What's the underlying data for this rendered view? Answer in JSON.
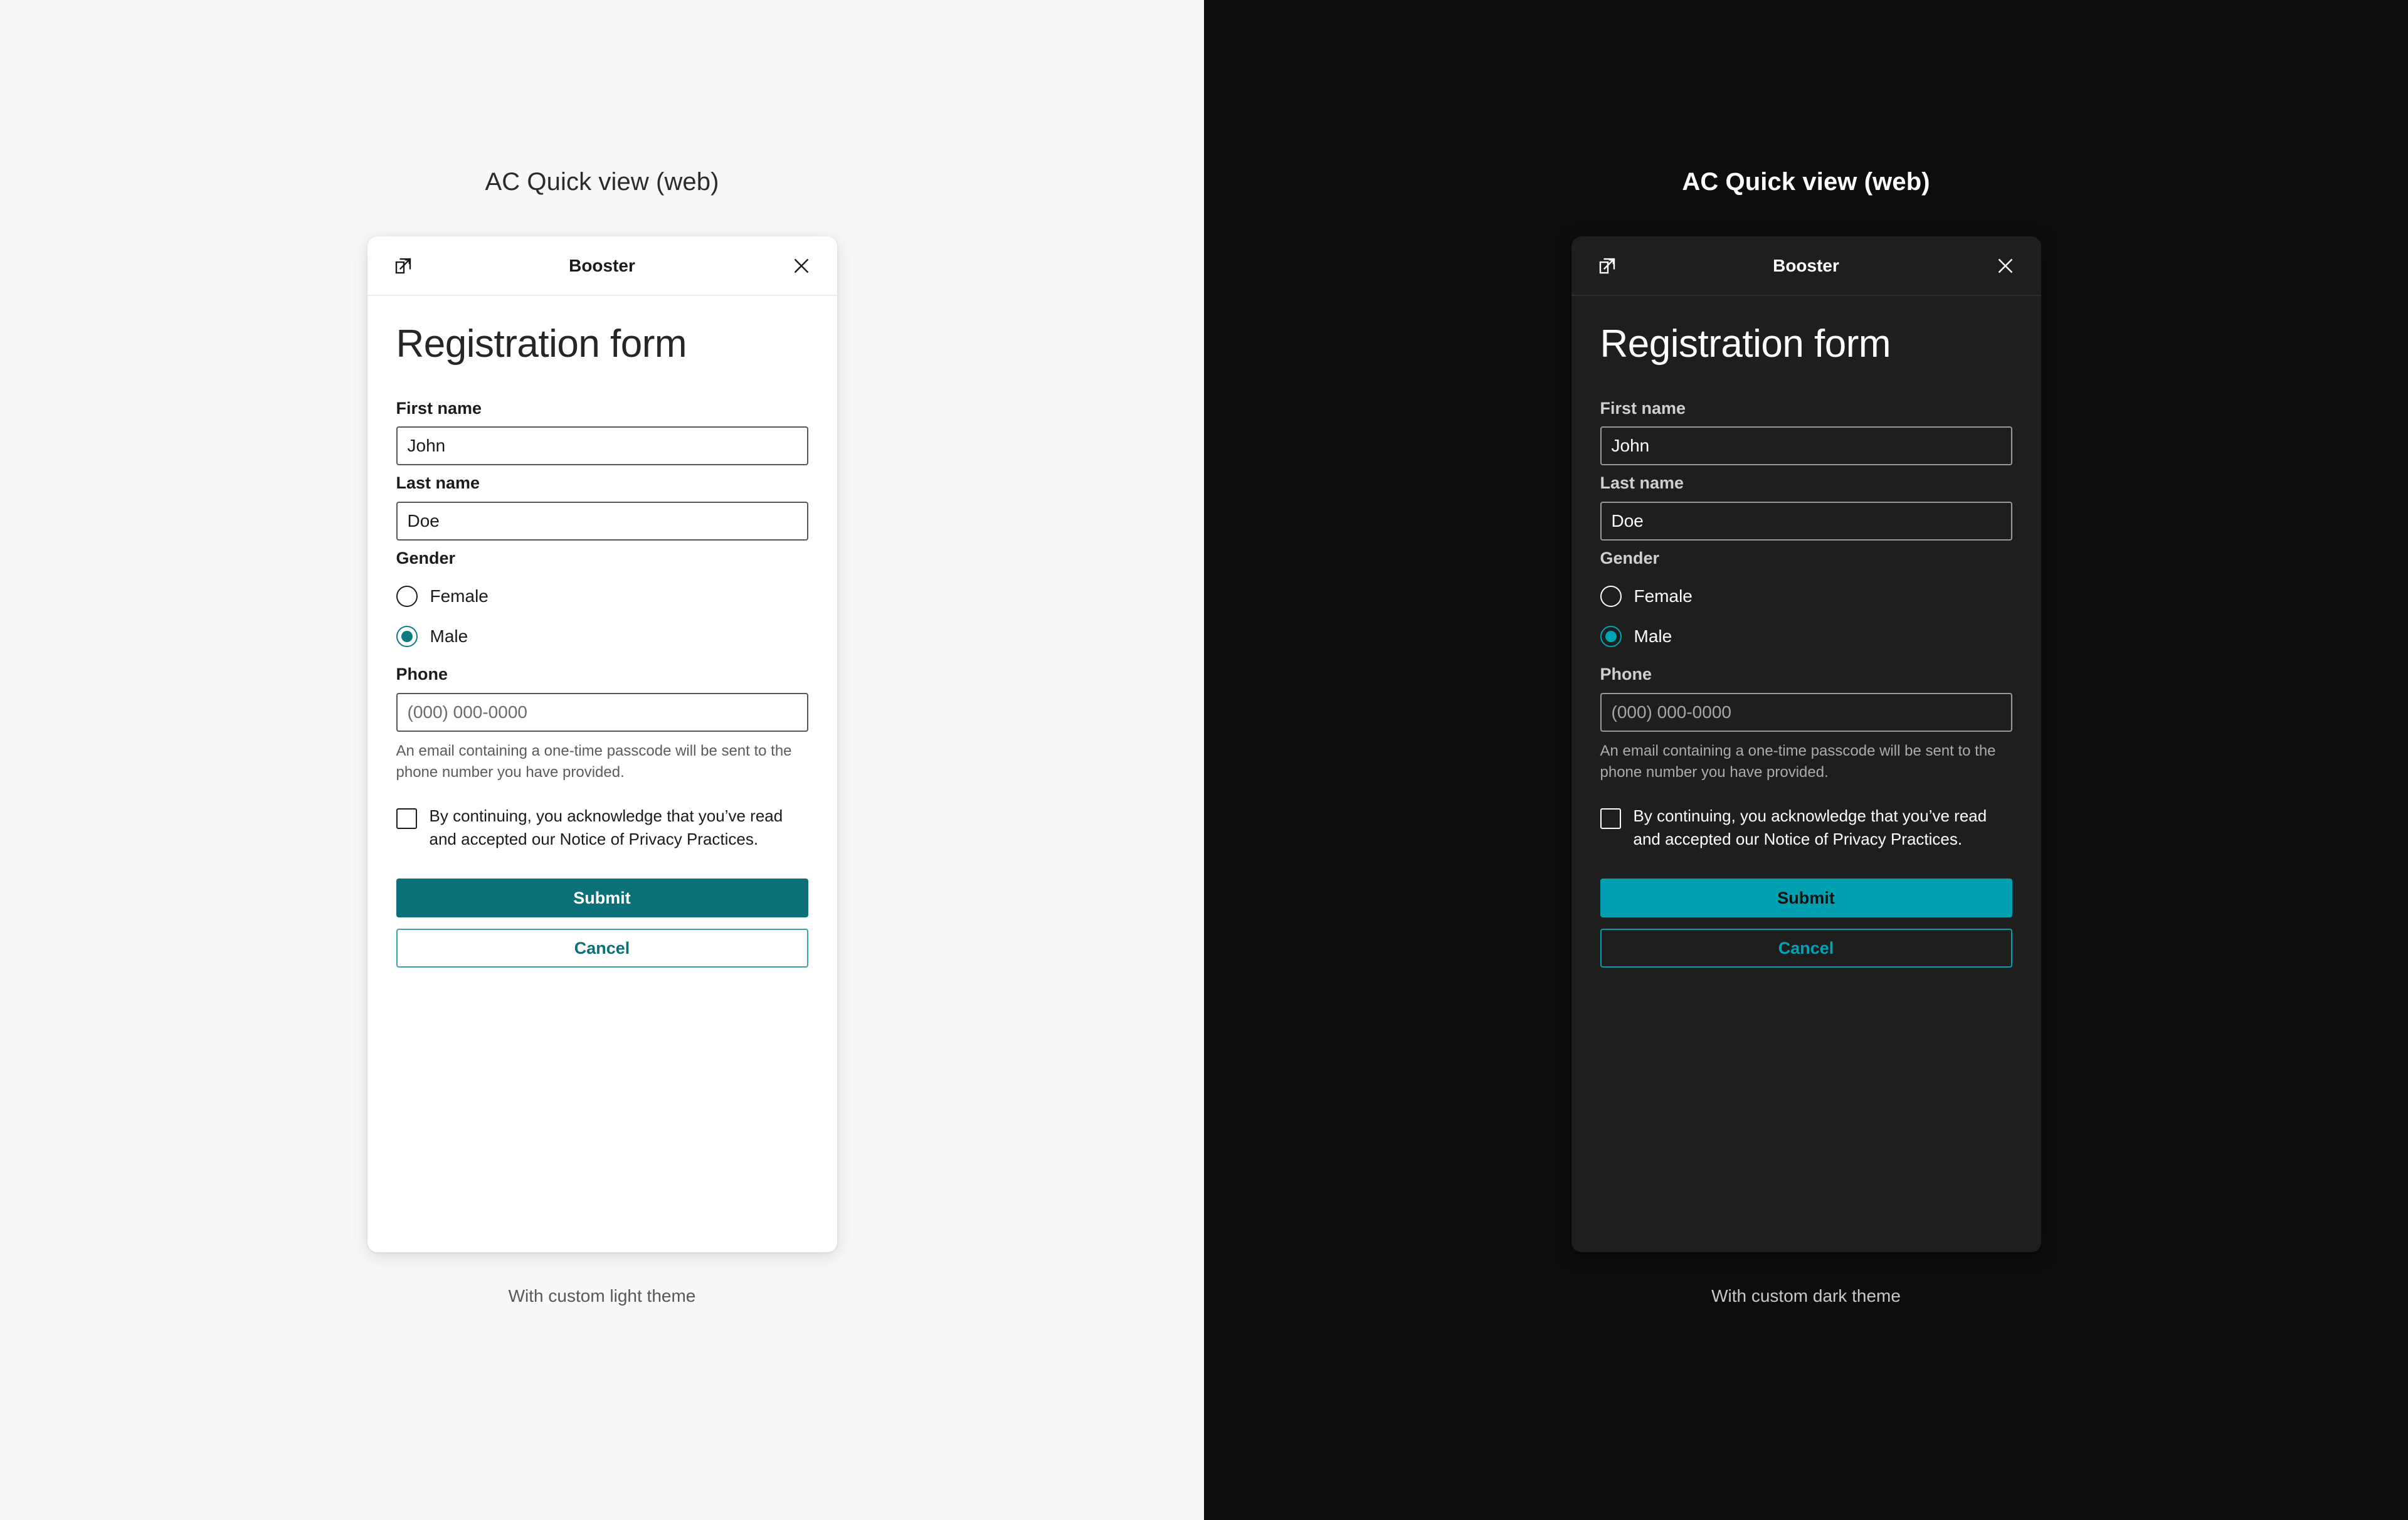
{
  "panels": [
    {
      "theme": "light",
      "title": "AC Quick view (web)",
      "caption": "With custom light theme",
      "card": {
        "header": {
          "popout_icon": "open-in-new-icon",
          "title": "Booster",
          "close_icon": "close-icon"
        },
        "form": {
          "heading": "Registration form",
          "first_name": {
            "label": "First name",
            "value": "John",
            "placeholder": ""
          },
          "last_name": {
            "label": "Last name",
            "value": "Doe",
            "placeholder": ""
          },
          "gender": {
            "label": "Gender",
            "options": [
              {
                "label": "Female",
                "selected": false
              },
              {
                "label": "Male",
                "selected": true
              }
            ]
          },
          "phone": {
            "label": "Phone",
            "value": "",
            "placeholder": "(000) 000-0000",
            "helper": "An email containing a one-time passcode will be sent to the phone number you have provided."
          },
          "consent": {
            "checked": false,
            "label": "By continuing, you acknowledge that you’ve read and accepted our Notice of Privacy Practices."
          },
          "submit_label": "Submit",
          "cancel_label": "Cancel"
        }
      }
    },
    {
      "theme": "dark",
      "title": "AC Quick view (web)",
      "caption": "With custom dark theme",
      "card": {
        "header": {
          "popout_icon": "open-in-new-icon",
          "title": "Booster",
          "close_icon": "close-icon"
        },
        "form": {
          "heading": "Registration form",
          "first_name": {
            "label": "First name",
            "value": "John",
            "placeholder": ""
          },
          "last_name": {
            "label": "Last name",
            "value": "Doe",
            "placeholder": ""
          },
          "gender": {
            "label": "Gender",
            "options": [
              {
                "label": "Female",
                "selected": false
              },
              {
                "label": "Male",
                "selected": true
              }
            ]
          },
          "phone": {
            "label": "Phone",
            "value": "",
            "placeholder": "(000) 000-0000",
            "helper": "An email containing a one-time passcode will be sent to the phone number you have provided."
          },
          "consent": {
            "checked": false,
            "label": "By continuing, you acknowledge that you’ve read and accepted our Notice of Privacy Practices."
          },
          "submit_label": "Submit",
          "cancel_label": "Cancel"
        }
      }
    }
  ],
  "colors": {
    "light_page_bg": "#f8f8f6",
    "dark_page_bg": "#0d0d0d",
    "light_card_bg": "#ffffff",
    "dark_card_bg": "#1e1e1e",
    "light_accent": "#0b7078",
    "dark_accent": "#00a0b0"
  }
}
